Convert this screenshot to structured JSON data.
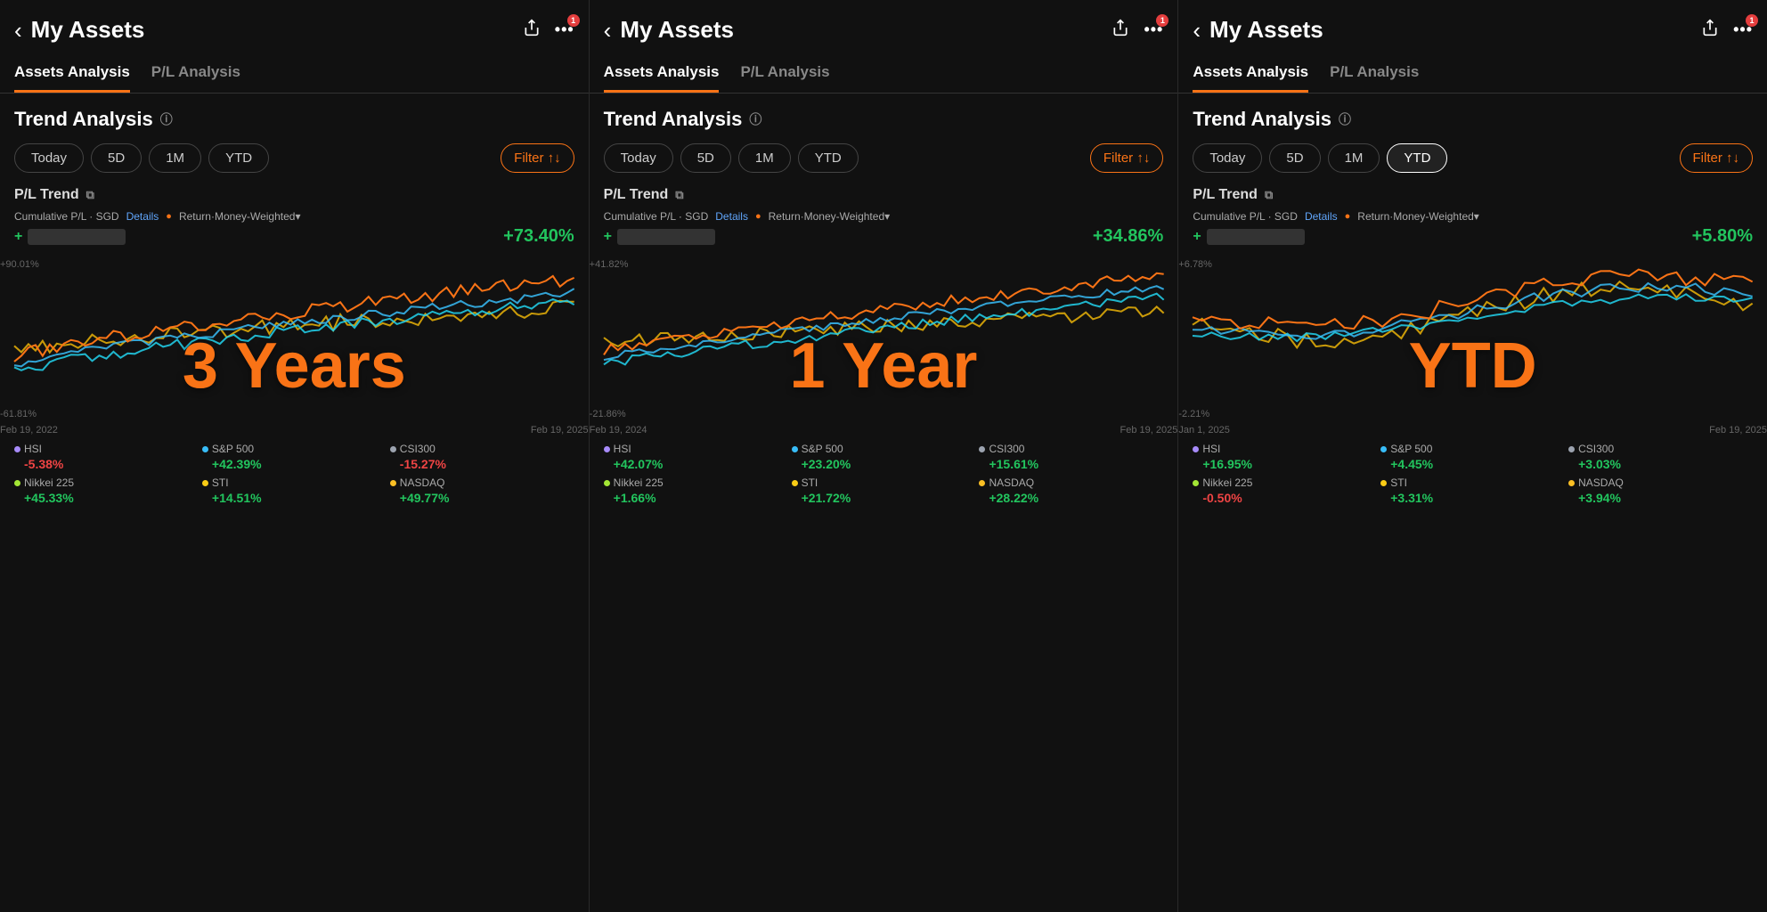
{
  "panels": [
    {
      "id": "panel-3y",
      "header": {
        "back_label": "‹",
        "title": "My Assets",
        "share_icon": "share",
        "more_icon": "more",
        "badge": "1"
      },
      "tabs": [
        {
          "label": "Assets Analysis",
          "active": true
        },
        {
          "label": "P/L Analysis",
          "active": false
        }
      ],
      "trend_analysis": {
        "title": "Trend Analysis",
        "info_icon": "ⓘ"
      },
      "time_buttons": [
        {
          "label": "Today",
          "active": false
        },
        {
          "label": "5D",
          "active": false
        },
        {
          "label": "1M",
          "active": false
        },
        {
          "label": "YTD",
          "active": false
        }
      ],
      "filter_label": "Filter ↑↓",
      "pl_trend_label": "P/L Trend",
      "chart_meta": {
        "cumulative": "Cumulative P/L · SGD",
        "details": "Details",
        "return_label": "Return·Money-Weighted▾"
      },
      "pl_return": "+73.40%",
      "big_label": "3 Years",
      "chart": {
        "y_top": "+90.01%",
        "y_bottom": "-61.81%",
        "date_left": "Feb 19, 2022",
        "date_right": "Feb 19, 2025"
      },
      "legend": [
        {
          "name": "HSI",
          "dot_color": "#a78bfa",
          "value": "-5.38%",
          "value_class": "red"
        },
        {
          "name": "S&P 500",
          "dot_color": "#38bdf8",
          "value": "+42.39%",
          "value_class": "green"
        },
        {
          "name": "CSI300",
          "dot_color": "#9ca3af",
          "value": "-15.27%",
          "value_class": "red"
        },
        {
          "name": "Nikkei 225",
          "dot_color": "#a3e635",
          "value": "+45.33%",
          "value_class": "green"
        },
        {
          "name": "STI",
          "dot_color": "#facc15",
          "value": "+14.51%",
          "value_class": "green"
        },
        {
          "name": "NASDAQ",
          "dot_color": "#fbbf24",
          "value": "+49.77%",
          "value_class": "green"
        }
      ]
    },
    {
      "id": "panel-1y",
      "header": {
        "back_label": "‹",
        "title": "My Assets",
        "share_icon": "share",
        "more_icon": "more",
        "badge": "1"
      },
      "tabs": [
        {
          "label": "Assets Analysis",
          "active": true
        },
        {
          "label": "P/L Analysis",
          "active": false
        }
      ],
      "trend_analysis": {
        "title": "Trend Analysis",
        "info_icon": "ⓘ"
      },
      "time_buttons": [
        {
          "label": "Today",
          "active": false
        },
        {
          "label": "5D",
          "active": false
        },
        {
          "label": "1M",
          "active": false
        },
        {
          "label": "YTD",
          "active": false
        }
      ],
      "filter_label": "Filter ↑↓",
      "pl_trend_label": "P/L Trend",
      "chart_meta": {
        "cumulative": "Cumulative P/L · SGD",
        "details": "Details",
        "return_label": "Return·Money-Weighted▾"
      },
      "pl_return": "+34.86%",
      "big_label": "1 Year",
      "chart": {
        "y_top": "+41.82%",
        "y_bottom": "-21.86%",
        "date_left": "Feb 19, 2024",
        "date_right": "Feb 19, 2025"
      },
      "legend": [
        {
          "name": "HSI",
          "dot_color": "#a78bfa",
          "value": "+42.07%",
          "value_class": "green"
        },
        {
          "name": "S&P 500",
          "dot_color": "#38bdf8",
          "value": "+23.20%",
          "value_class": "green"
        },
        {
          "name": "CSI300",
          "dot_color": "#9ca3af",
          "value": "+15.61%",
          "value_class": "green"
        },
        {
          "name": "Nikkei 225",
          "dot_color": "#a3e635",
          "value": "+1.66%",
          "value_class": "green"
        },
        {
          "name": "STI",
          "dot_color": "#facc15",
          "value": "+21.72%",
          "value_class": "green"
        },
        {
          "name": "NASDAQ",
          "dot_color": "#fbbf24",
          "value": "+28.22%",
          "value_class": "green"
        }
      ]
    },
    {
      "id": "panel-ytd",
      "header": {
        "back_label": "‹",
        "title": "My Assets",
        "share_icon": "share",
        "more_icon": "more",
        "badge": "1"
      },
      "tabs": [
        {
          "label": "Assets Analysis",
          "active": true
        },
        {
          "label": "P/L Analysis",
          "active": false
        }
      ],
      "trend_analysis": {
        "title": "Trend Analysis",
        "info_icon": "ⓘ"
      },
      "time_buttons": [
        {
          "label": "Today",
          "active": false
        },
        {
          "label": "5D",
          "active": false
        },
        {
          "label": "1M",
          "active": false
        },
        {
          "label": "YTD",
          "active": true
        }
      ],
      "filter_label": "Filter ↑↓",
      "pl_trend_label": "P/L Trend",
      "chart_meta": {
        "cumulative": "Cumulative P/L · SGD",
        "details": "Details",
        "return_label": "Return·Money-Weighted▾"
      },
      "pl_return": "+5.80%",
      "big_label": "YTD",
      "chart": {
        "y_top": "+6.78%",
        "y_bottom": "-2.21%",
        "date_left": "Jan 1, 2025",
        "date_right": "Feb 19, 2025"
      },
      "legend": [
        {
          "name": "HSI",
          "dot_color": "#a78bfa",
          "value": "+16.95%",
          "value_class": "green"
        },
        {
          "name": "S&P 500",
          "dot_color": "#38bdf8",
          "value": "+4.45%",
          "value_class": "green"
        },
        {
          "name": "CSI300",
          "dot_color": "#9ca3af",
          "value": "+3.03%",
          "value_class": "green"
        },
        {
          "name": "Nikkei 225",
          "dot_color": "#a3e635",
          "value": "-0.50%",
          "value_class": "red"
        },
        {
          "name": "STI",
          "dot_color": "#facc15",
          "value": "+3.31%",
          "value_class": "green"
        },
        {
          "name": "NASDAQ",
          "dot_color": "#fbbf24",
          "value": "+3.94%",
          "value_class": "green"
        }
      ]
    }
  ],
  "icons": {
    "back": "‹",
    "share": "⎋",
    "more": "•••",
    "info": "ⓘ",
    "copy": "⧉"
  }
}
